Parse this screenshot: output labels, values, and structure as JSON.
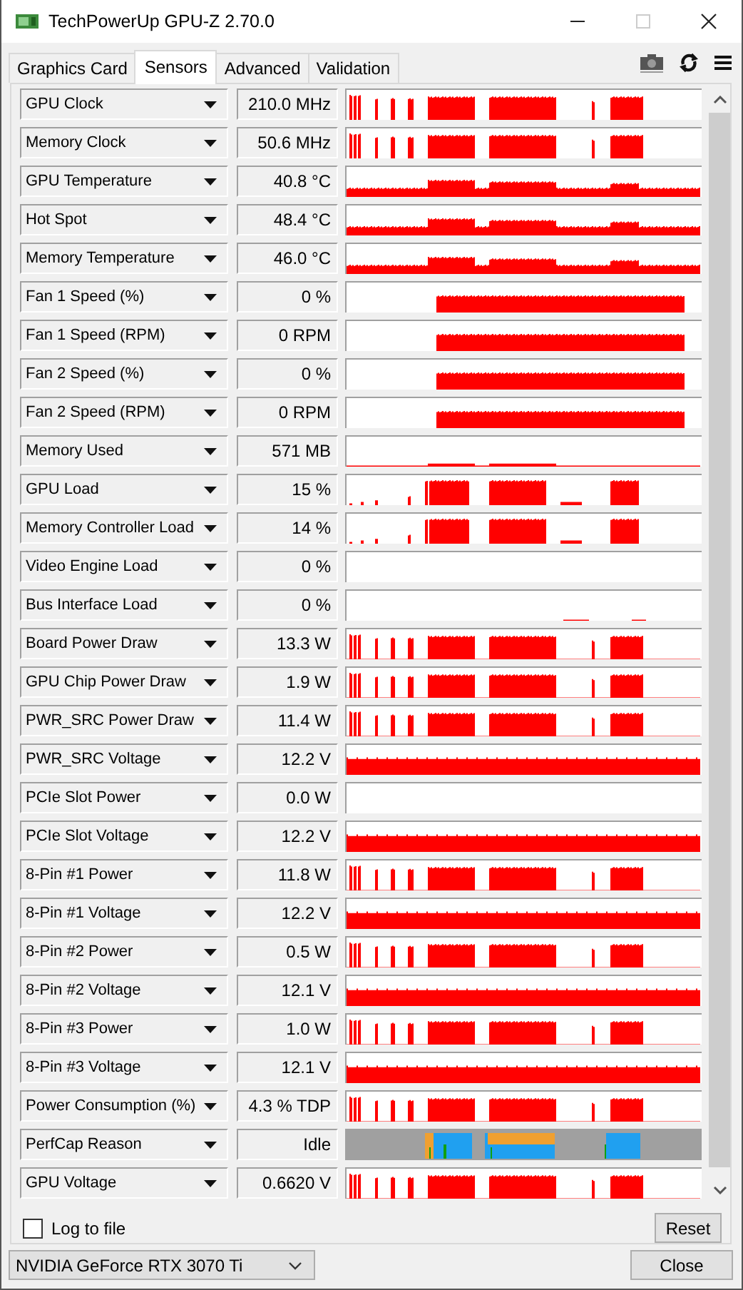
{
  "window": {
    "title": "TechPowerUp GPU-Z 2.70.0"
  },
  "tabs": [
    {
      "label": "Graphics Card",
      "selected": false
    },
    {
      "label": "Sensors",
      "selected": true
    },
    {
      "label": "Advanced",
      "selected": false
    },
    {
      "label": "Validation",
      "selected": false
    }
  ],
  "sensors": [
    {
      "name": "GPU Clock",
      "value": "210.0 MHz",
      "kind": "clock"
    },
    {
      "name": "Memory Clock",
      "value": "50.6 MHz",
      "kind": "clock"
    },
    {
      "name": "GPU Temperature",
      "value": "40.8 °C",
      "kind": "temperature"
    },
    {
      "name": "Hot Spot",
      "value": "48.4 °C",
      "kind": "temperature"
    },
    {
      "name": "Memory Temperature",
      "value": "46.0 °C",
      "kind": "temperature"
    },
    {
      "name": "Fan 1 Speed (%)",
      "value": "0 %",
      "kind": "fan"
    },
    {
      "name": "Fan 1 Speed (RPM)",
      "value": "0 RPM",
      "kind": "fan"
    },
    {
      "name": "Fan 2 Speed (%)",
      "value": "0 %",
      "kind": "fan"
    },
    {
      "name": "Fan 2 Speed (RPM)",
      "value": "0 RPM",
      "kind": "fan"
    },
    {
      "name": "Memory Used",
      "value": "571 MB",
      "kind": "usage"
    },
    {
      "name": "GPU Load",
      "value": "15 %",
      "kind": "load"
    },
    {
      "name": "Memory Controller Load",
      "value": "14 %",
      "kind": "load"
    },
    {
      "name": "Video Engine Load",
      "value": "0 %",
      "kind": "empty"
    },
    {
      "name": "Bus Interface Load",
      "value": "0 %",
      "kind": "trace"
    },
    {
      "name": "Board Power Draw",
      "value": "13.3 W",
      "kind": "power"
    },
    {
      "name": "GPU Chip Power Draw",
      "value": "1.9 W",
      "kind": "power"
    },
    {
      "name": "PWR_SRC Power Draw",
      "value": "11.4 W",
      "kind": "power"
    },
    {
      "name": "PWR_SRC Voltage",
      "value": "12.2 V",
      "kind": "voltage"
    },
    {
      "name": "PCIe Slot Power",
      "value": "0.0 W",
      "kind": "empty"
    },
    {
      "name": "PCIe Slot Voltage",
      "value": "12.2 V",
      "kind": "voltage"
    },
    {
      "name": "8-Pin #1 Power",
      "value": "11.8 W",
      "kind": "power"
    },
    {
      "name": "8-Pin #1 Voltage",
      "value": "12.2 V",
      "kind": "voltage"
    },
    {
      "name": "8-Pin #2 Power",
      "value": "0.5 W",
      "kind": "power"
    },
    {
      "name": "8-Pin #2 Voltage",
      "value": "12.1 V",
      "kind": "voltage"
    },
    {
      "name": "8-Pin #3 Power",
      "value": "1.0 W",
      "kind": "power"
    },
    {
      "name": "8-Pin #3 Voltage",
      "value": "12.1 V",
      "kind": "voltage"
    },
    {
      "name": "Power Consumption (%)",
      "value": "4.3 % TDP",
      "kind": "power"
    },
    {
      "name": "PerfCap Reason",
      "value": "Idle",
      "kind": "perfcap"
    },
    {
      "name": "GPU Voltage",
      "value": "0.6620 V",
      "kind": "power"
    }
  ],
  "log_to_file": {
    "label": "Log to file",
    "checked": false
  },
  "reset_button": "Reset",
  "gpu_select": {
    "value": "NVIDIA GeForce RTX 3070 Ti"
  },
  "close_button": "Close"
}
